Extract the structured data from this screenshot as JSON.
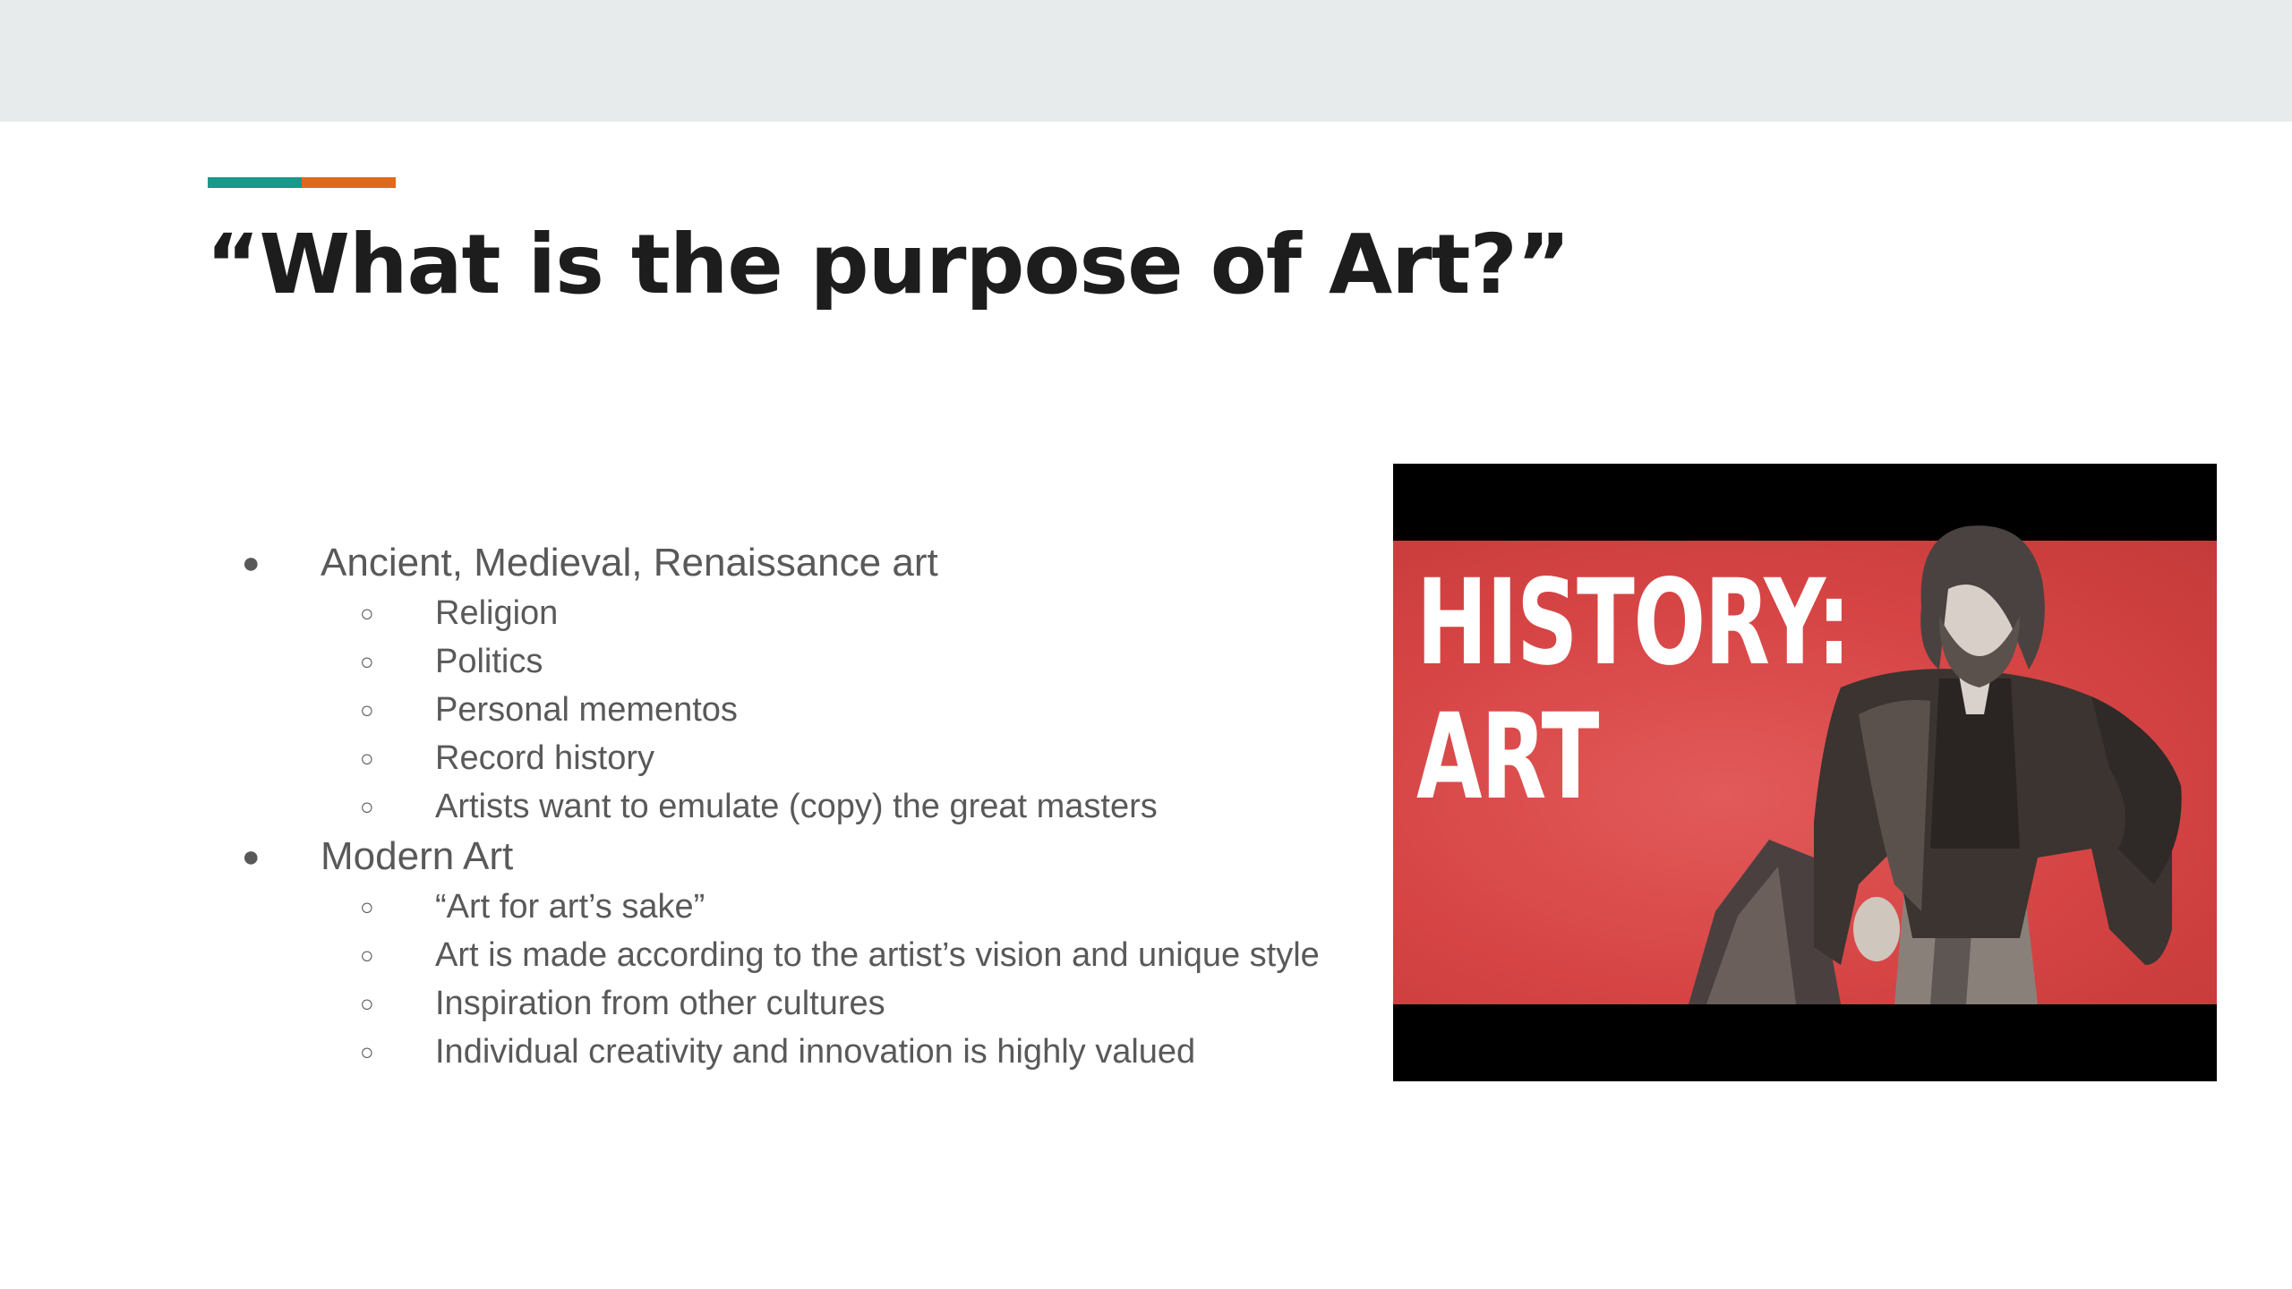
{
  "slide": {
    "title": "“What is the purpose of Art?”",
    "accent_colors": [
      "#17998c",
      "#e06a1c"
    ],
    "bullets": [
      {
        "text": "Ancient, Medieval, Renaissance art",
        "marker": "●",
        "children": [
          {
            "text": "Religion",
            "marker": "○"
          },
          {
            "text": "Politics",
            "marker": "○"
          },
          {
            "text": "Personal mementos",
            "marker": "○"
          },
          {
            "text": "Record history",
            "marker": "○"
          },
          {
            "text": "Artists want to emulate (copy) the great masters",
            "marker": "○"
          }
        ]
      },
      {
        "text": "Modern Art",
        "marker": "●",
        "children": [
          {
            "text": "“Art for art’s sake”",
            "marker": "○"
          },
          {
            "text": "Art is made according to the artist’s vision and unique style",
            "marker": "○"
          },
          {
            "text": "Inspiration from other cultures",
            "marker": "○"
          },
          {
            "text": "Individual creativity and innovation is highly valued",
            "marker": "○"
          }
        ]
      }
    ],
    "thumbnail": {
      "line1": "HISTORY:",
      "line2": "ART",
      "background_color": "#d64444",
      "figure_icon": "portrait-engraving-icon"
    }
  }
}
